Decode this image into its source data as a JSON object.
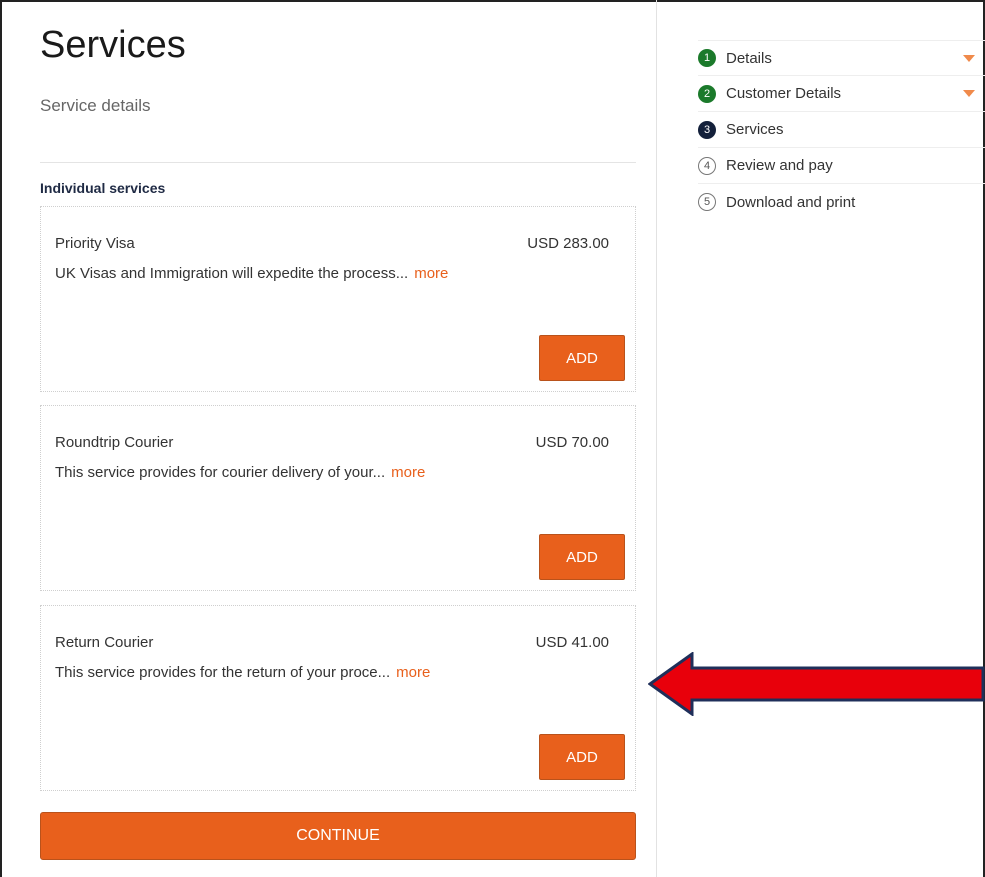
{
  "header": {
    "title": "Services",
    "subtitle": "Service details"
  },
  "section_label": "Individual services",
  "services": [
    {
      "name": "Priority Visa",
      "price": "USD 283.00",
      "description": "UK Visas and Immigration will expedite the process...",
      "more_label": "more",
      "add_label": "ADD"
    },
    {
      "name": "Roundtrip Courier",
      "price": "USD 70.00",
      "description": "This service provides for courier delivery of your...",
      "more_label": "more",
      "add_label": "ADD"
    },
    {
      "name": "Return Courier",
      "price": "USD 41.00",
      "description": "This service provides for the return of your proce...",
      "more_label": "more",
      "add_label": "ADD"
    }
  ],
  "continue_label": "CONTINUE",
  "steps": [
    {
      "number": "1",
      "label": "Details",
      "state": "done"
    },
    {
      "number": "2",
      "label": "Customer Details",
      "state": "done"
    },
    {
      "number": "3",
      "label": "Services",
      "state": "current"
    },
    {
      "number": "4",
      "label": "Review and pay",
      "state": "todo"
    },
    {
      "number": "5",
      "label": "Download and print",
      "state": "todo"
    }
  ],
  "colors": {
    "accent": "#e8601c",
    "step_done": "#1b7a2b",
    "step_current": "#13203a",
    "annotation_arrow": "#e8000b"
  }
}
